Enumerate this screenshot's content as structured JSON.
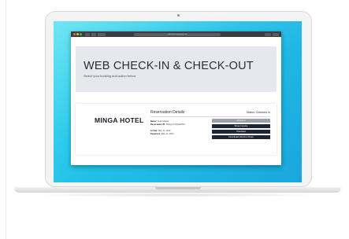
{
  "browser": {
    "url": "webcheckin.mingahotel.com"
  },
  "hero": {
    "title": "WEB CHECK-IN & CHECK-OUT",
    "subtitle": "Select your booking and action below"
  },
  "card": {
    "logo_text": "MINGA HOTEL",
    "section_title": "Reservation Details",
    "status_label": "Status:",
    "status_value": "Checked In",
    "fields": [
      {
        "label": "Name:",
        "value": "Sepp Muster"
      },
      {
        "label": "Reservation ID:",
        "value": "KDepyJY2QN0ehR3"
      },
      {
        "label": "Arrival:",
        "value": "May 11, 2020"
      },
      {
        "label": "Departure:",
        "value": "May 11, 2020"
      }
    ],
    "buttons": [
      {
        "label": "Check-in",
        "state": "disabled"
      },
      {
        "label": "Show Invoice",
        "state": "enabled"
      },
      {
        "label": "Checkout",
        "state": "enabled"
      },
      {
        "label": "Download Check-in Pass",
        "state": "enabled"
      }
    ]
  },
  "colors": {
    "screen_bg": "#22c1e8",
    "button_dark": "#1d2636",
    "button_disabled": "#9ca1a8",
    "hero_bg": "#e5e8ed"
  }
}
